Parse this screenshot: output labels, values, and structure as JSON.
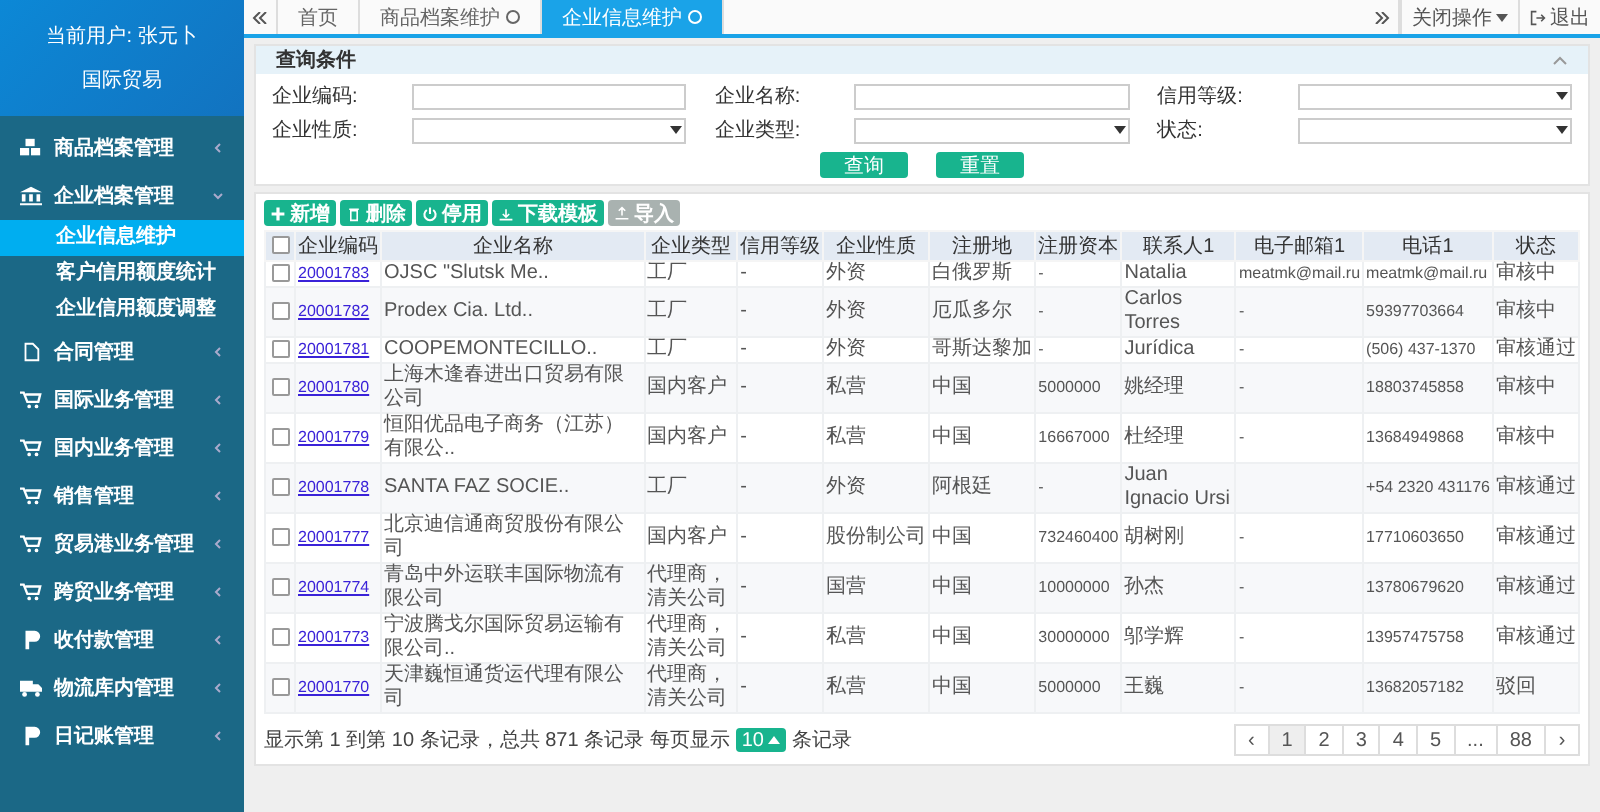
{
  "sidebar": {
    "user": "当前用户: 张元卜",
    "org": "国际贸易",
    "menu": [
      {
        "label": "商品档案管理",
        "expanded": false
      },
      {
        "label": "企业档案管理",
        "expanded": true,
        "children": [
          {
            "label": "企业信息维护",
            "selected": true
          },
          {
            "label": "客户信用额度统计",
            "selected": false
          },
          {
            "label": "企业信用额度调整",
            "selected": false
          }
        ]
      },
      {
        "label": "合同管理",
        "expanded": false
      },
      {
        "label": "国际业务管理",
        "expanded": false
      },
      {
        "label": "国内业务管理",
        "expanded": false
      },
      {
        "label": "销售管理",
        "expanded": false
      },
      {
        "label": "贸易港业务管理",
        "expanded": false
      },
      {
        "label": "跨贸业务管理",
        "expanded": false
      },
      {
        "label": "收付款管理",
        "expanded": false
      },
      {
        "label": "物流库内管理",
        "expanded": false
      },
      {
        "label": "日记账管理",
        "expanded": false
      }
    ]
  },
  "tabs": [
    {
      "label": "首页",
      "selected": false,
      "closable": false
    },
    {
      "label": "商品档案维护",
      "selected": false,
      "closable": true
    },
    {
      "label": "企业信息维护",
      "selected": true,
      "closable": true
    }
  ],
  "close_menu": "关闭操作",
  "logout": "退出",
  "query": {
    "title": "查询条件",
    "fields": [
      {
        "label": "企业编码:",
        "kind": "text"
      },
      {
        "label": "企业名称:",
        "kind": "text"
      },
      {
        "label": "信用等级:",
        "kind": "select"
      },
      {
        "label": "企业性质:",
        "kind": "select"
      },
      {
        "label": "企业类型:",
        "kind": "select"
      },
      {
        "label": "状态:",
        "kind": "select"
      }
    ],
    "buttons": [
      "查询",
      "重置"
    ]
  },
  "toolbar": [
    {
      "label": "新增",
      "disabled": false
    },
    {
      "label": "删除",
      "disabled": false
    },
    {
      "label": "停用",
      "disabled": false
    },
    {
      "label": "下载模板",
      "disabled": false
    },
    {
      "label": "导入",
      "disabled": true
    }
  ],
  "table": {
    "all_checked": false,
    "columns": [
      "企业编码",
      "企业名称",
      "企业类型",
      "信用等级",
      "企业性质",
      "注册地",
      "注册资本",
      "联系人1",
      "电子邮箱1",
      "电话1",
      "状态"
    ],
    "rows": [
      {
        "checked": false,
        "cells": [
          "20001783",
          "OJSC \"Slutsk Me..",
          "工厂",
          "-",
          "外资",
          "白俄罗斯",
          "-",
          "Natalia",
          "meatmk@mail.ru",
          "meatmk@mail.ru",
          "审核中"
        ]
      },
      {
        "checked": false,
        "cells": [
          "20001782",
          "Prodex Cia. Ltd..",
          "工厂",
          "-",
          "外资",
          "厄瓜多尔",
          "-",
          "Carlos Torres",
          "-",
          "59397703664",
          "审核中"
        ]
      },
      {
        "checked": false,
        "cells": [
          "20001781",
          "COOPEMONTECILLO..",
          "工厂",
          "-",
          "外资",
          "哥斯达黎加",
          "-",
          "Jurídica",
          "-",
          "(506) 437-1370",
          "审核通过"
        ]
      },
      {
        "checked": false,
        "cells": [
          "20001780",
          "上海木逢春进出口贸易有限公司",
          "国内客户",
          "-",
          "私营",
          "中国",
          "5000000",
          "姚经理",
          "-",
          "18803745858",
          "审核中"
        ]
      },
      {
        "checked": false,
        "cells": [
          "20001779",
          "恒阳优品电子商务（江苏）有限公..",
          "国内客户",
          "-",
          "私营",
          "中国",
          "16667000",
          "杜经理",
          "-",
          "13684949868",
          "审核中"
        ]
      },
      {
        "checked": false,
        "cells": [
          "20001778",
          "SANTA FAZ SOCIE..",
          "工厂",
          "-",
          "外资",
          "阿根廷",
          "-",
          "Juan Ignacio Ursi",
          "",
          "+54 2320 431176",
          "审核通过"
        ]
      },
      {
        "checked": false,
        "cells": [
          "20001777",
          "北京迪信通商贸股份有限公司",
          "国内客户",
          "-",
          "股份制公司",
          "中国",
          "732460400",
          "胡树刚",
          "-",
          "17710603650",
          "审核通过"
        ]
      },
      {
        "checked": false,
        "cells": [
          "20001774",
          "青岛中外运联丰国际物流有限公司",
          "代理商，清关公司",
          "-",
          "国营",
          "中国",
          "10000000",
          "孙杰",
          "-",
          "13780679620",
          "审核通过"
        ]
      },
      {
        "checked": false,
        "cells": [
          "20001773",
          "宁波腾戈尔国际贸易运输有限公司..",
          "代理商，清关公司",
          "-",
          "私营",
          "中国",
          "30000000",
          "邬学辉",
          "-",
          "13957475758",
          "审核通过"
        ]
      },
      {
        "checked": false,
        "cells": [
          "20001770",
          "天津巍恒通货运代理有限公司",
          "代理商，清关公司",
          "-",
          "私营",
          "中国",
          "5000000",
          "王巍",
          "-",
          "13682057182",
          "驳回"
        ]
      }
    ]
  },
  "pagination": {
    "summary": "显示第 1 到第 10 条记录，总共 871 条记录 每页显示",
    "page_size": "10",
    "suffix": "条记录",
    "prev": "‹",
    "next": "›",
    "pages": [
      {
        "label": "1",
        "selected": true
      },
      {
        "label": "2",
        "selected": false
      },
      {
        "label": "3",
        "selected": false
      },
      {
        "label": "4",
        "selected": false
      },
      {
        "label": "5",
        "selected": false
      },
      {
        "label": "...",
        "selected": false
      },
      {
        "label": "88",
        "selected": false
      }
    ]
  }
}
